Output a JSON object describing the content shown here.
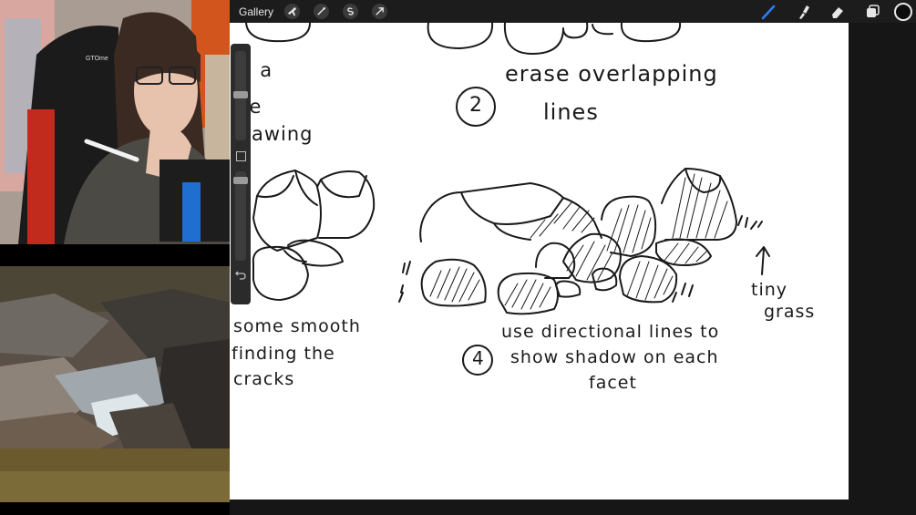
{
  "toolbar": {
    "gallery_label": "Gallery",
    "left_tools": [
      {
        "name": "wrench-icon"
      },
      {
        "name": "magic-wand-icon"
      },
      {
        "name": "selection-icon"
      },
      {
        "name": "transform-arrow-icon"
      }
    ],
    "right_tools": [
      {
        "name": "brush-icon",
        "color": "#2f7bf5"
      },
      {
        "name": "smudge-icon"
      },
      {
        "name": "eraser-icon"
      },
      {
        "name": "layers-icon"
      }
    ],
    "active_color": "#0d0d0d"
  },
  "canvas": {
    "notes": {
      "left_1": "th a",
      "left_2": "me",
      "left_3": "drawing",
      "step2_number": "2",
      "step2_line1": "erase overlapping",
      "step2_line2": "lines",
      "left_4": "some smooth",
      "left_5": "finding the",
      "left_6": "cracks",
      "step4_number": "4",
      "step4_line1": "use directional lines to",
      "step4_line2": "show shadow on each",
      "step4_line3": "facet",
      "grass_1": "tiny",
      "grass_2": "grass"
    }
  }
}
